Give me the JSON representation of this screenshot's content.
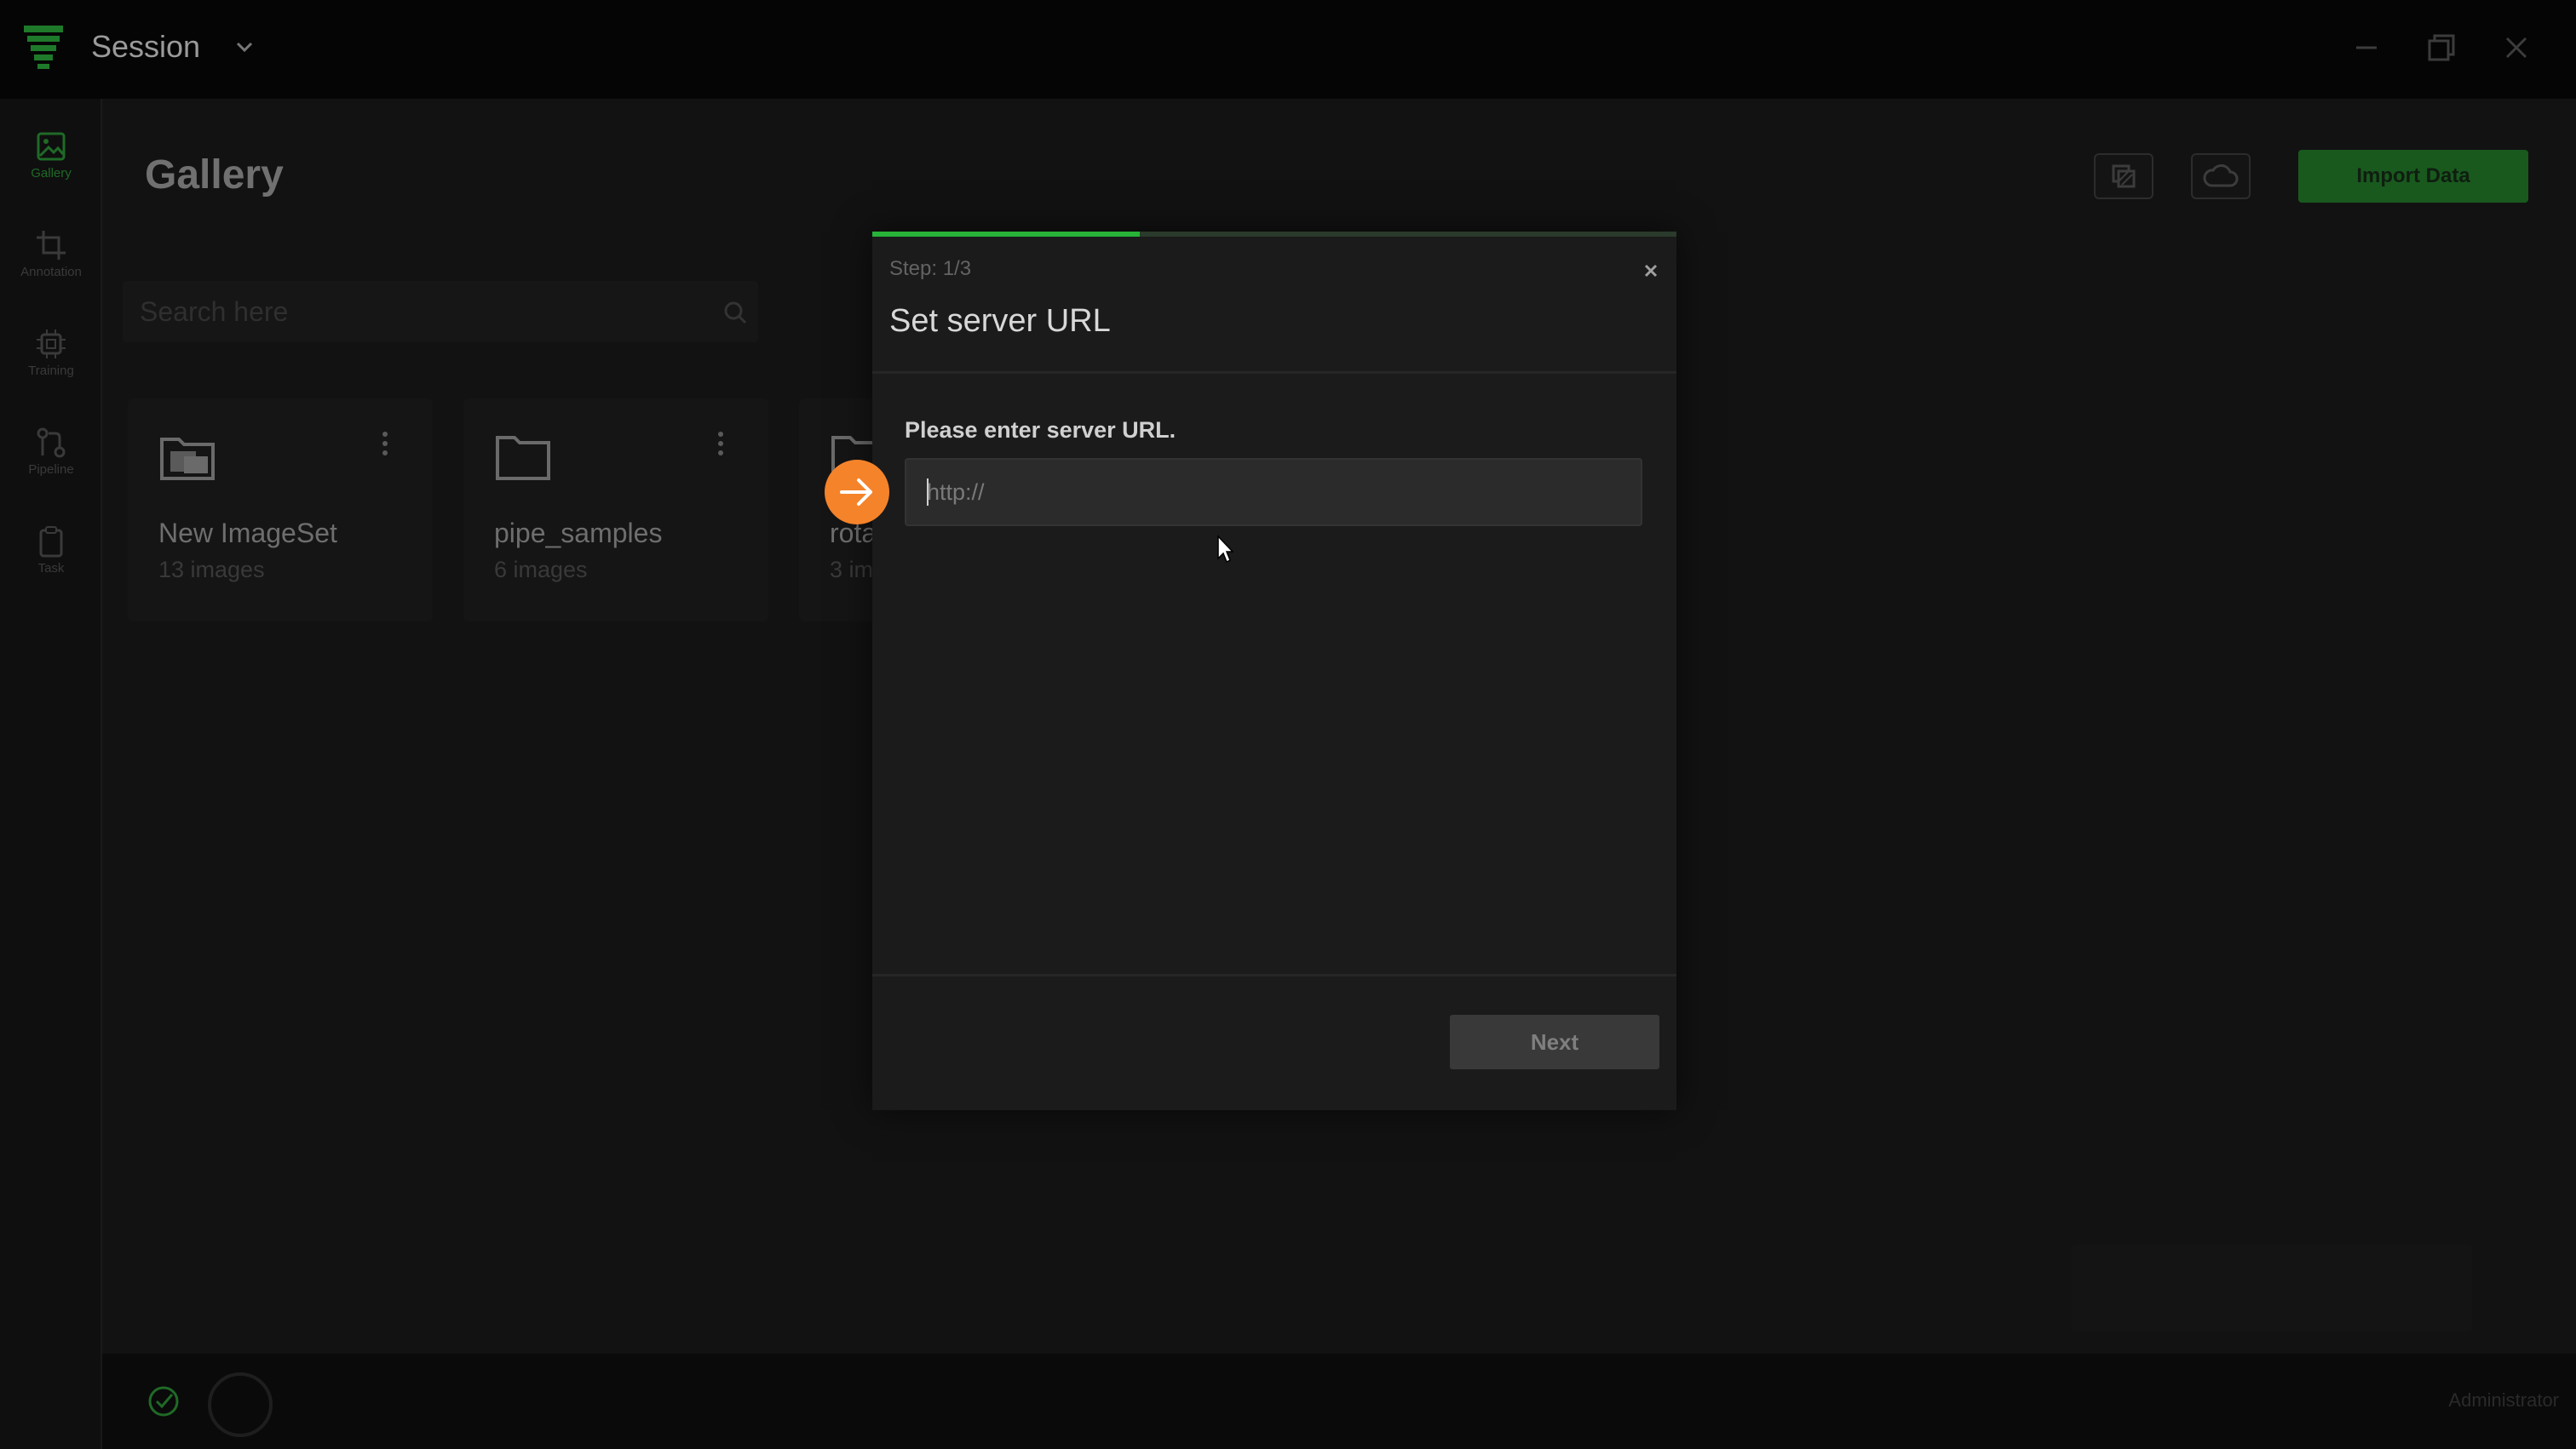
{
  "titlebar": {
    "session_label": "Session"
  },
  "sidebar": {
    "items": [
      {
        "label": "Gallery",
        "icon": "image-icon",
        "active": true
      },
      {
        "label": "Annotation",
        "icon": "crop-icon",
        "active": false
      },
      {
        "label": "Training",
        "icon": "chip-icon",
        "active": false
      },
      {
        "label": "Pipeline",
        "icon": "pipeline-icon",
        "active": false
      },
      {
        "label": "Task",
        "icon": "clipboard-icon",
        "active": false
      }
    ]
  },
  "main": {
    "title": "Gallery",
    "import_label": "Import Data",
    "search_placeholder": "Search here",
    "cards": [
      {
        "name": "New ImageSet",
        "count": "13 images"
      },
      {
        "name": "pipe_samples",
        "count": "6 images"
      },
      {
        "name": "rota",
        "count": "3 im"
      }
    ]
  },
  "modal": {
    "step": "Step: 1/3",
    "title": "Set server URL",
    "field_label": "Please enter server URL.",
    "url_placeholder": "http://",
    "next_label": "Next",
    "progress_fraction": 0.333
  },
  "statusbar": {
    "user": "Administrator"
  },
  "colors": {
    "accent": "#27b337",
    "import_button": "#19591e",
    "pointer": "#f5832a"
  }
}
